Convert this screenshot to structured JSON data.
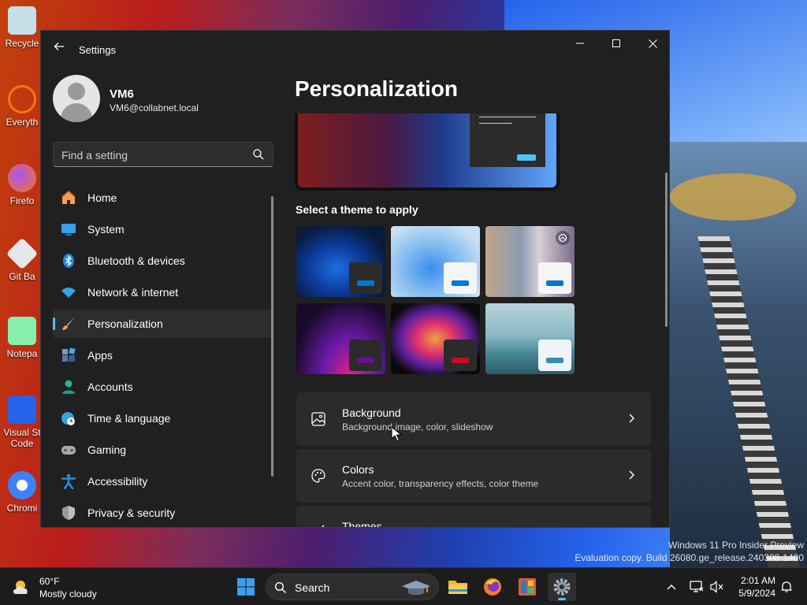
{
  "desktop": {
    "icons": [
      {
        "label": "Recycle"
      },
      {
        "label": "Everyth"
      },
      {
        "label": "Firefo"
      },
      {
        "label": "Git Ba"
      },
      {
        "label": "Notepa"
      },
      {
        "label": "Visual St Code"
      },
      {
        "label": "Chromi"
      }
    ],
    "watermark": {
      "line1": "Windows 11 Pro Insider Preview",
      "line2": "Evaluation copy. Build 26080.ge_release.240308-1400"
    }
  },
  "window": {
    "title": "Settings",
    "back_icon": "arrow-left-icon",
    "controls": [
      "minimize-icon",
      "maximize-icon",
      "close-icon"
    ]
  },
  "profile": {
    "name": "VM6",
    "email": "VM6@collabnet.local"
  },
  "search": {
    "placeholder": "Find a setting",
    "value": ""
  },
  "sidebar": {
    "items": [
      {
        "label": "Home",
        "icon": "home-icon",
        "active": false
      },
      {
        "label": "System",
        "icon": "monitor-icon",
        "active": false
      },
      {
        "label": "Bluetooth & devices",
        "icon": "bluetooth-icon",
        "active": false
      },
      {
        "label": "Network & internet",
        "icon": "wifi-icon",
        "active": false
      },
      {
        "label": "Personalization",
        "icon": "brush-icon",
        "active": true
      },
      {
        "label": "Apps",
        "icon": "apps-icon",
        "active": false
      },
      {
        "label": "Accounts",
        "icon": "person-icon",
        "active": false
      },
      {
        "label": "Time & language",
        "icon": "globe-clock-icon",
        "active": false
      },
      {
        "label": "Gaming",
        "icon": "gamepad-icon",
        "active": false
      },
      {
        "label": "Accessibility",
        "icon": "accessibility-icon",
        "active": false
      },
      {
        "label": "Privacy & security",
        "icon": "shield-icon",
        "active": false
      }
    ]
  },
  "main": {
    "title": "Personalization",
    "theme_heading": "Select a theme to apply",
    "themes": [
      {
        "name": "windows-dark-theme",
        "accent": "#0078d4"
      },
      {
        "name": "windows-light-theme",
        "accent": "#0078d4"
      },
      {
        "name": "spotlight-theme",
        "accent": "#0078d4"
      },
      {
        "name": "glow-theme",
        "accent": "#6b0f8f"
      },
      {
        "name": "captured-motion-theme",
        "accent": "#c50f1f"
      },
      {
        "name": "flow-theme",
        "accent": "#3a8fb0"
      }
    ],
    "cards": [
      {
        "title": "Background",
        "subtitle": "Background image, color, slideshow",
        "icon": "image-icon"
      },
      {
        "title": "Colors",
        "subtitle": "Accent color, transparency effects, color theme",
        "icon": "palette-icon"
      },
      {
        "title": "Themes",
        "subtitle": "",
        "icon": "brush-icon"
      }
    ]
  },
  "taskbar": {
    "weather_temp": "60°F",
    "weather_desc": "Mostly cloudy",
    "search_label": "Search",
    "time": "2:01 AM",
    "date": "5/9/2024",
    "pinned": [
      "windows-start-icon",
      "file-explorer-icon",
      "firefox-icon",
      "app-icon",
      "settings-gear-icon"
    ],
    "tray": [
      "chevron-up-icon",
      "network-icon",
      "speaker-muted-icon",
      "bell-icon"
    ]
  },
  "colors": {
    "accent": "#4cc2ff",
    "window_bg": "#202020",
    "card_bg": "#2b2b2b"
  }
}
